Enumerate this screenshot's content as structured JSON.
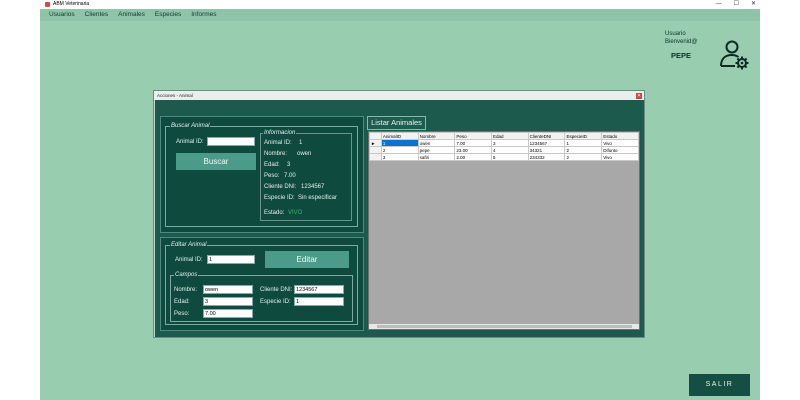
{
  "window": {
    "title": "ABM Veterinaria",
    "controls": [
      "—",
      "☐",
      "✕"
    ]
  },
  "menu": [
    "Usuarios",
    "Clientes",
    "Animales",
    "Especies",
    "Informes"
  ],
  "user": {
    "label": "Usuario",
    "welcome": "Bienvenid@",
    "name": "PEPE",
    "icon": "user-gear-icon"
  },
  "exit_label": "SALIR",
  "dialog": {
    "title": "Acciones - Animal",
    "close": "✕",
    "search": {
      "legend": "Buscar Animal",
      "id_label": "Animal ID:",
      "id_value": "",
      "button": "Buscar"
    },
    "info": {
      "legend": "Informacion",
      "animal_id_label": "Animal ID:",
      "animal_id": "1",
      "nombre_label": "Nombre:",
      "nombre": "owen",
      "edad_label": "Edad:",
      "edad": "3",
      "peso_label": "Peso:",
      "peso": "7.00",
      "cliente_label": "Cliente DNI:",
      "cliente": "1234567",
      "especie_label": "Especie ID:",
      "especie": "Sin especificar",
      "estado_label": "Estado:",
      "estado": "VIVO"
    },
    "edit": {
      "legend": "Editar Animal",
      "id_label": "Animal ID:",
      "id_value": "1",
      "button": "Editar",
      "fields_legend": "Campos",
      "nombre_label": "Nombre:",
      "nombre": "owen",
      "edad_label": "Edad:",
      "edad": "3",
      "peso_label": "Peso:",
      "peso": "7.00",
      "cliente_label": "Cliente DNI:",
      "cliente": "1234567",
      "especie_label": "Especie ID:",
      "especie": "1"
    },
    "list": {
      "title": "Listar Animales",
      "columns": [
        "AnimalID",
        "Nombre",
        "Peso",
        "Edad",
        "ClienteDNI",
        "EspecieID",
        "Estado"
      ],
      "rows": [
        [
          "1",
          "owen",
          "7.00",
          "3",
          "1234567",
          "1",
          "Vivo"
        ],
        [
          "2",
          "pepe",
          "23.00",
          "4",
          "34321",
          "2",
          "Difunto"
        ],
        [
          "3",
          "safiri",
          "2.00",
          "5",
          "234332",
          "2",
          "Vivo"
        ]
      ],
      "selected_row": 0,
      "current_marker": "►"
    }
  },
  "colors": {
    "app_bg": "#98cdb0",
    "panel": "#0f4a3f",
    "accent": "#4a9b89",
    "exit": "#154f43",
    "estado_vivo": "#35b56a"
  }
}
